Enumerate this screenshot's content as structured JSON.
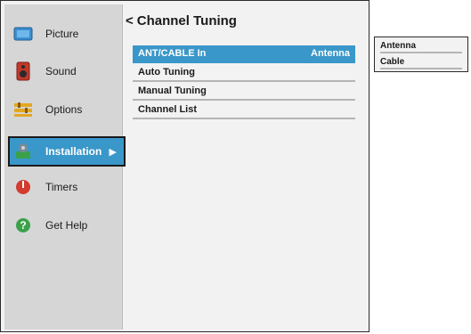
{
  "sidebar": {
    "items": [
      {
        "label": "Picture"
      },
      {
        "label": "Sound"
      },
      {
        "label": "Options"
      },
      {
        "label": "Installation"
      },
      {
        "label": "Timers"
      },
      {
        "label": "Get Help"
      }
    ],
    "selected_arrow": "▶"
  },
  "panel": {
    "back_glyph": "<",
    "title": "Channel Tuning",
    "rows": [
      {
        "label": "ANT/CABLE In",
        "value": "Antenna"
      },
      {
        "label": "Auto Tuning",
        "value": ""
      },
      {
        "label": "Manual Tuning",
        "value": ""
      },
      {
        "label": "Channel List",
        "value": ""
      }
    ]
  },
  "dropdown": {
    "options": [
      "Antenna",
      "Cable"
    ]
  },
  "colors": {
    "accent": "#3a97c9",
    "sidebar_bg": "#d6d6d6",
    "panel_bg": "#f2f2f2"
  },
  "icons": [
    "picture-icon",
    "sound-icon",
    "options-icon",
    "installation-icon",
    "timers-icon",
    "help-icon"
  ]
}
